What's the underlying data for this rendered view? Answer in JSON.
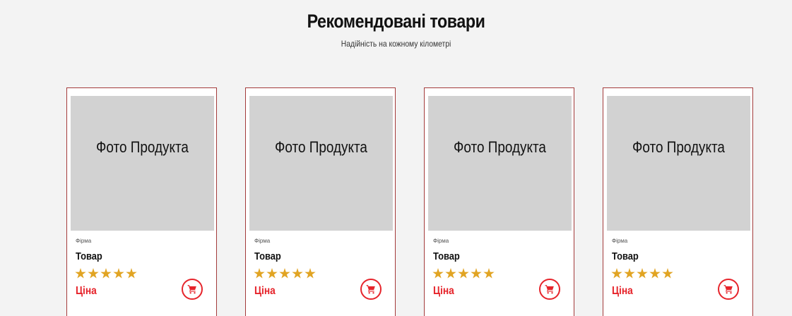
{
  "header": {
    "title": "Рекомендовані товари",
    "subtitle": "Надійність на кожному кілометрі"
  },
  "products": [
    {
      "photo_label": "Фото Продукта",
      "brand": "Фірма",
      "name": "Товар",
      "rating": 5,
      "rating_max": 5,
      "price": "Ціна"
    },
    {
      "photo_label": "Фото Продукта",
      "brand": "Фірма",
      "name": "Товар",
      "rating": 5,
      "rating_max": 5,
      "price": "Ціна"
    },
    {
      "photo_label": "Фото Продукта",
      "brand": "Фірма",
      "name": "Товар",
      "rating": 5,
      "rating_max": 5,
      "price": "Ціна"
    },
    {
      "photo_label": "Фото Продукта",
      "brand": "Фірма",
      "name": "Товар",
      "rating": 5,
      "rating_max": 5,
      "price": "Ціна"
    }
  ],
  "icons": {
    "star": "star-icon",
    "cart": "shopping-cart-icon"
  },
  "colors": {
    "card_border": "#a33a3a",
    "price": "#e6242b",
    "star": "#e1a423",
    "photo_placeholder": "#d2d2d2",
    "background": "#f3f3f3"
  }
}
